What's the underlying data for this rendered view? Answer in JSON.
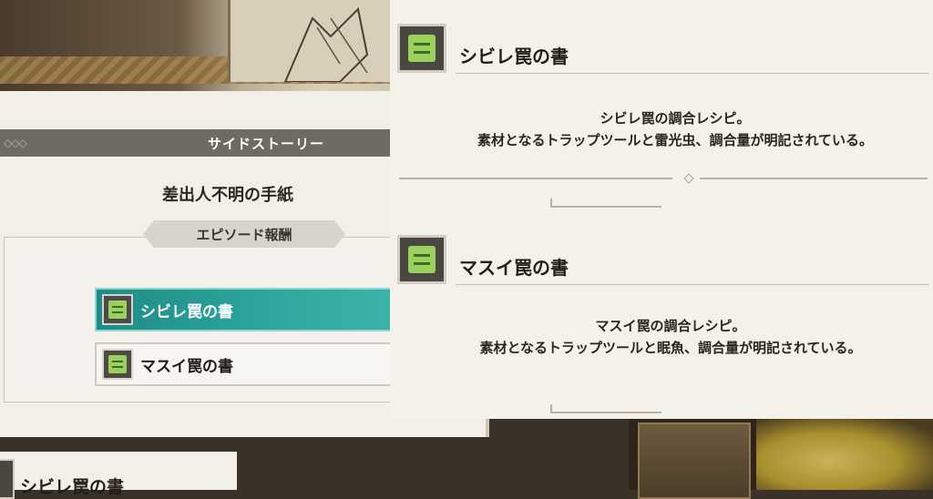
{
  "side_story": {
    "header": "サイドストーリー",
    "header_ornament": "◇◇◇",
    "title": "差出人不明の手紙",
    "reward_label": "エピソード報酬",
    "rewards": [
      {
        "label": "シビレ罠の書",
        "icon": "scroll-book-icon",
        "selected": true
      },
      {
        "label": "マスイ罠の書",
        "icon": "scroll-book-icon",
        "selected": false
      }
    ]
  },
  "details": [
    {
      "name": "シビレ罠の書",
      "icon": "scroll-book-icon",
      "desc_line1": "シビレ罠の調合レシピ。",
      "desc_line2": "素材となるトラップツールと雷光虫、調合量が明記されている。"
    },
    {
      "name": "マスイ罠の書",
      "icon": "scroll-book-icon",
      "desc_line1": "マスイ罠の調合レシピ。",
      "desc_line2": "素材となるトラップツールと眠魚、調合量が明記されている。"
    }
  ],
  "bottom_partial": {
    "label": "シビレ罠の書"
  },
  "colors": {
    "selected_teal": "#2ea79e",
    "icon_green": "#9ad05c",
    "header_gray": "#6f6a64",
    "panel_bg": "#f4f1eb"
  }
}
